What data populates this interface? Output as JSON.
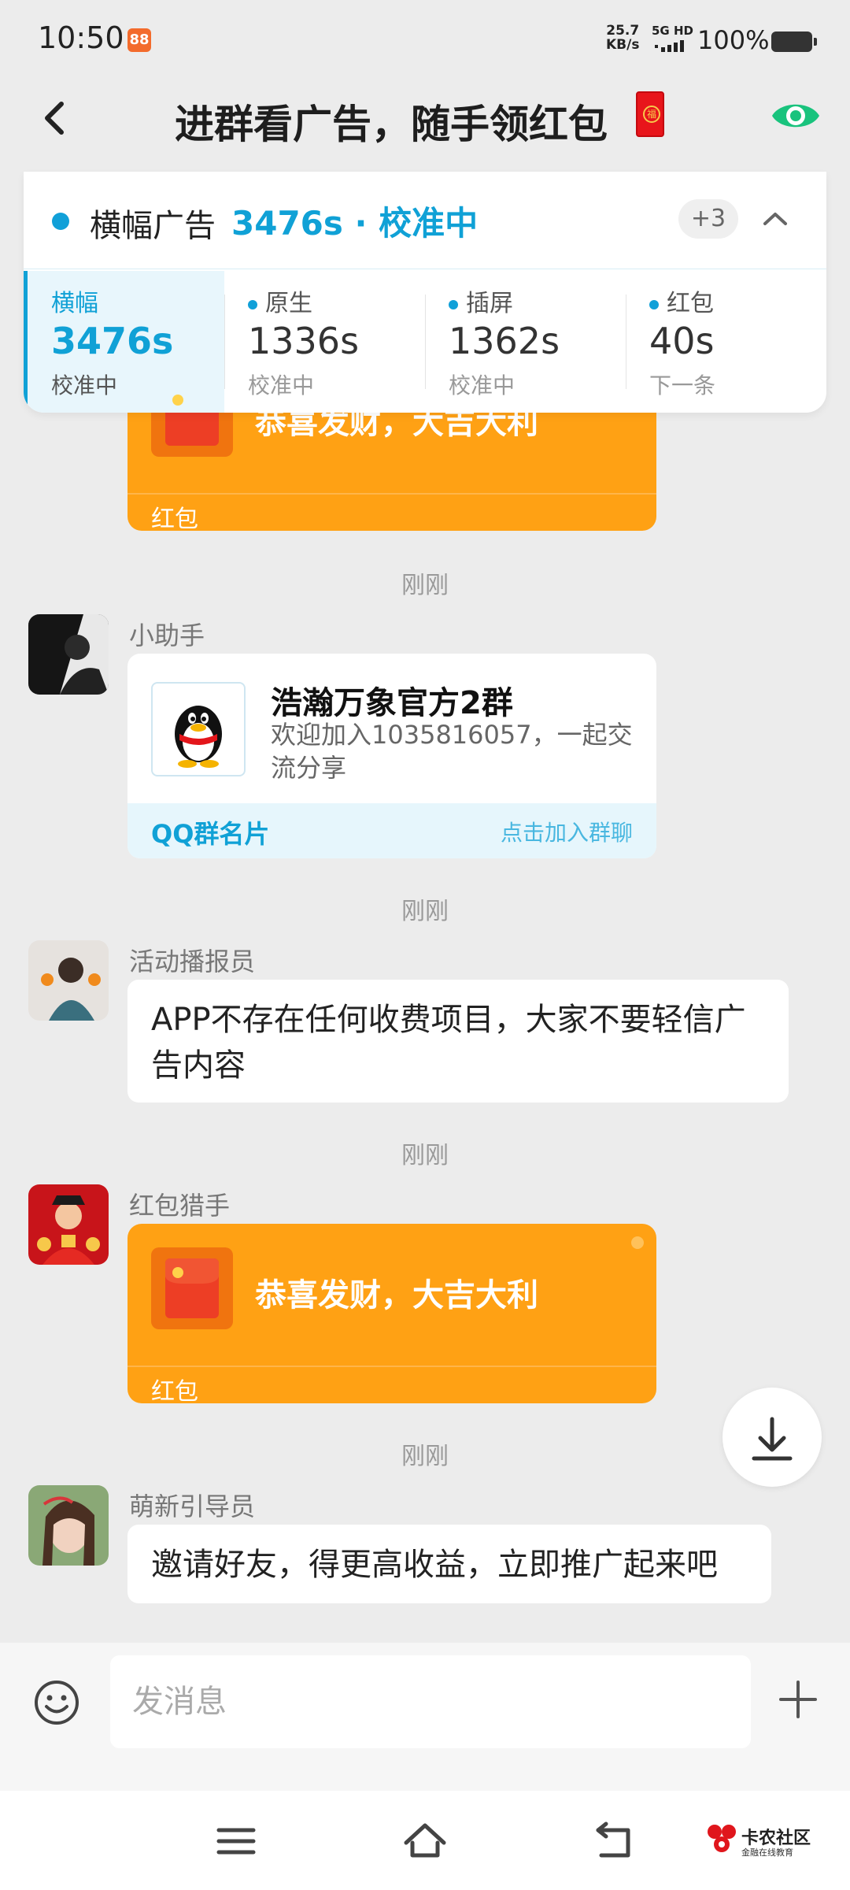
{
  "status_bar": {
    "time": "10:50",
    "app_badge": "88",
    "net_speed_value": "25.7",
    "net_speed_unit": "KB/s",
    "network": "5G HD",
    "battery": "100%"
  },
  "header": {
    "title": "进群看广告，随手领红包",
    "title_emoji": "福"
  },
  "ad_panel": {
    "head_label": "横幅广告",
    "head_status": "3476s · 校准中",
    "more_count": "+3",
    "cells": [
      {
        "name": "横幅",
        "value": "3476s",
        "sub": "校准中",
        "active": true
      },
      {
        "name": "原生",
        "value": "1336s",
        "sub": "校准中",
        "active": false
      },
      {
        "name": "插屏",
        "value": "1362s",
        "sub": "校准中",
        "active": false
      },
      {
        "name": "红包",
        "value": "40s",
        "sub": "下一条",
        "active": false
      }
    ]
  },
  "messages": {
    "top_hongbao": {
      "text": "恭喜发财，大吉大利",
      "footer": "红包"
    },
    "ts1": "刚刚",
    "qq": {
      "sender": "小助手",
      "title": "浩瀚万象官方2群",
      "desc": "欢迎加入1035816057，一起交流分享",
      "footer_left": "QQ群名片",
      "footer_right": "点击加入群聊"
    },
    "ts2": "刚刚",
    "notice": {
      "sender": "活动播报员",
      "text": "APP不存在任何收费项目，大家不要轻信广告内容"
    },
    "ts3": "刚刚",
    "hongbao2": {
      "sender": "红包猎手",
      "text": "恭喜发财，大吉大利",
      "footer": "红包"
    },
    "ts4": "刚刚",
    "invite": {
      "sender": "萌新引导员",
      "text": "邀请好友，得更高收益，立即推广起来吧"
    }
  },
  "input": {
    "placeholder": "发消息"
  },
  "watermark": {
    "title": "卡农社区",
    "subtitle": "金融在线教育"
  },
  "colors": {
    "accent": "#10a1d6",
    "hongbao": "#ffa114",
    "eye": "#19c37d",
    "background": "#ececec"
  },
  "icons": [
    "back-icon",
    "hongbao-emoji-icon",
    "eye-icon",
    "chevron-up-icon",
    "hongbao-envelope-icon",
    "qq-penguin-icon",
    "download-icon",
    "emoji-icon",
    "plus-icon",
    "menu-icon",
    "home-icon",
    "return-icon"
  ]
}
